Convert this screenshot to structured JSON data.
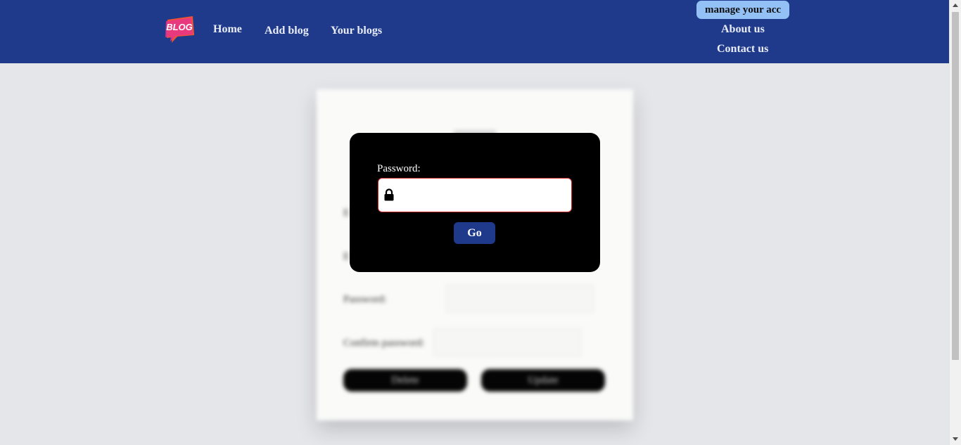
{
  "header": {
    "logo_text": "BLOG",
    "nav": {
      "home": "Home",
      "add_blog": "Add blog",
      "your_blogs": "Your blogs",
      "manage_account": "manage your acc",
      "about": "About us",
      "contact": "Contact us"
    }
  },
  "background_form": {
    "password_label": "Password:",
    "confirm_password_label": "Confirm password:",
    "delete_button": "Delete",
    "update_button": "Update"
  },
  "modal": {
    "password_label": "Password:",
    "password_value": "",
    "go_button": "Go"
  },
  "colors": {
    "header_bg": "#1f3a8a",
    "manage_button_bg": "#93c0f5",
    "modal_bg": "#000000",
    "input_border": "#c82828",
    "page_bg": "#e5e6ea"
  },
  "icons": {
    "lock": "lock-icon"
  }
}
